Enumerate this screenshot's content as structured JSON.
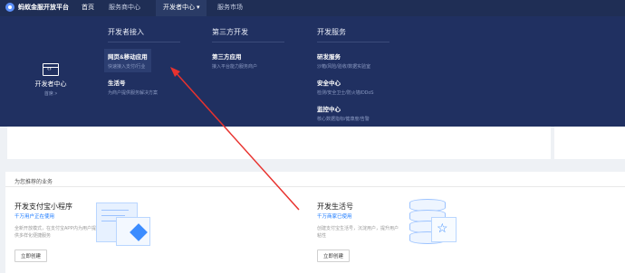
{
  "topbar": {
    "logo_text": "蚂蚁金服开放平台",
    "nav": [
      {
        "label": "首页"
      },
      {
        "label": "服务商中心"
      },
      {
        "label": "开发者中心 ▾"
      },
      {
        "label": "服务市场"
      }
    ]
  },
  "dropdown": {
    "left": {
      "title": "开发者中心",
      "sub": "首席 >"
    },
    "columns": [
      {
        "title": "开发者接入",
        "entries": [
          {
            "title": "网页&移动应用",
            "desc": "快速接入支付/行业"
          },
          {
            "title": "生活号",
            "desc": "为商户提供服务解决方案"
          }
        ]
      },
      {
        "title": "第三方开发",
        "entries": [
          {
            "title": "第三方应用",
            "desc": "接入平台能力服务商户"
          }
        ]
      },
      {
        "title": "开发服务",
        "entries": [
          {
            "title": "研发服务",
            "desc": "沙箱/风险/验收/数据实验室"
          },
          {
            "title": "安全中心",
            "desc": "检测/安全卫士/防火墙/DDoS"
          },
          {
            "title": "监控中心",
            "desc": "核心数据指标/健康度/告警"
          }
        ]
      }
    ]
  },
  "recommend": {
    "title": "为您推荐的业务",
    "cards": [
      {
        "title": "开发支付宝小程序",
        "status": "千万用户正在使用",
        "desc": "全新开放模式，在支付宝APP内为用户提供多样化便捷服务",
        "button": "立即创建"
      },
      {
        "title": "开发生活号",
        "status": "千万商家已使用",
        "desc": "创建支付宝生活号，沉淀用户，提升用户粘性",
        "button": "立即创建"
      }
    ]
  },
  "colors": {
    "topbar": "#1f2e55",
    "dropdown": "#203061",
    "accent": "#1677ff",
    "arrow": "#e8322e"
  }
}
